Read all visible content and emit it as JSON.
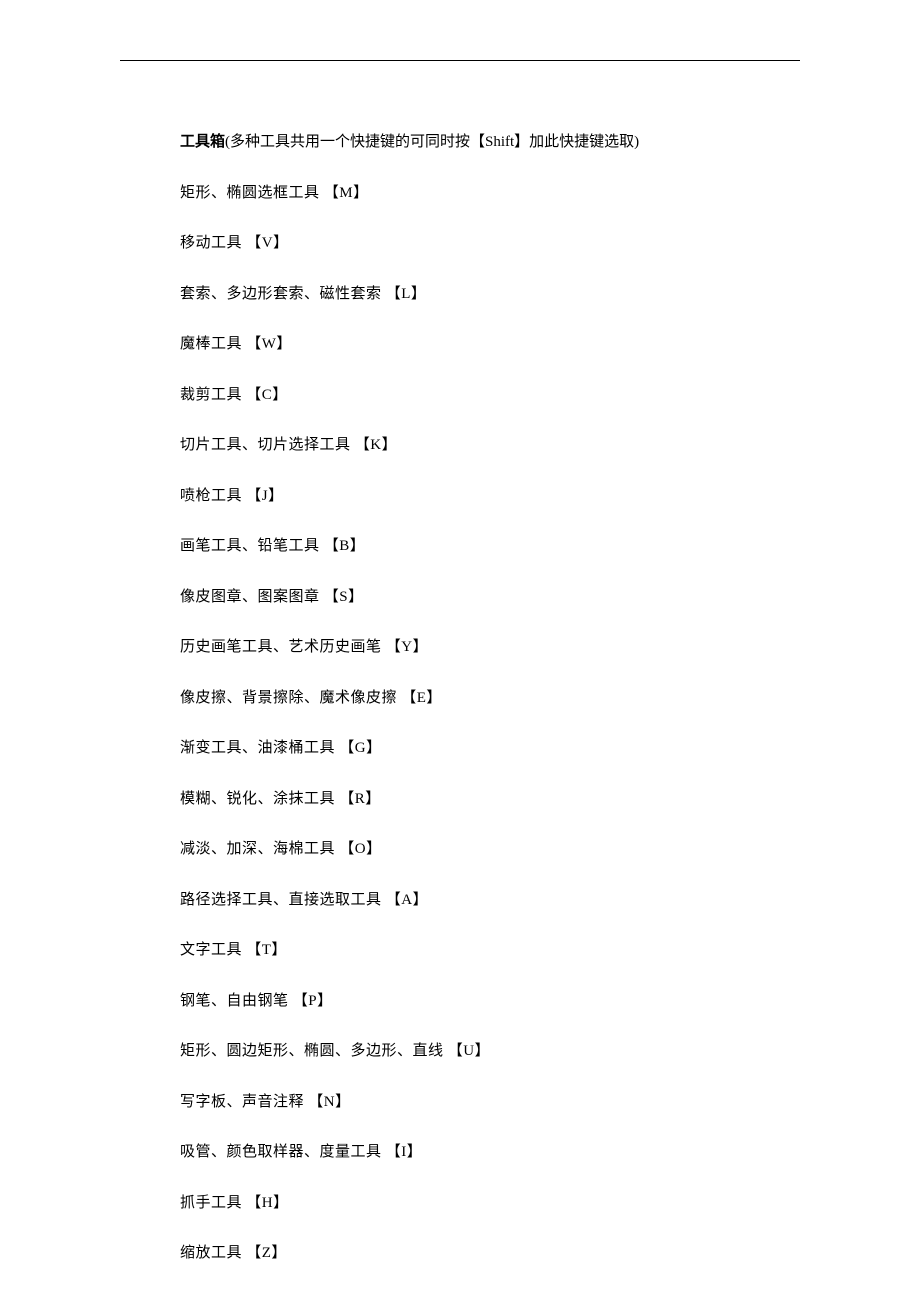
{
  "heading": {
    "title": "工具箱",
    "subtitle": "(多种工具共用一个快捷键的可同时按【Shift】加此快捷键选取)"
  },
  "shortcuts": [
    {
      "label": "矩形、椭圆选框工具 【M】"
    },
    {
      "label": "移动工具 【V】"
    },
    {
      "label": "套索、多边形套索、磁性套索 【L】"
    },
    {
      "label": "魔棒工具 【W】"
    },
    {
      "label": "裁剪工具 【C】"
    },
    {
      "label": "切片工具、切片选择工具 【K】"
    },
    {
      "label": "喷枪工具 【J】"
    },
    {
      "label": "画笔工具、铅笔工具 【B】"
    },
    {
      "label": "像皮图章、图案图章 【S】"
    },
    {
      "label": "历史画笔工具、艺术历史画笔 【Y】"
    },
    {
      "label": "像皮擦、背景擦除、魔术像皮擦 【E】"
    },
    {
      "label": "渐变工具、油漆桶工具 【G】"
    },
    {
      "label": "模糊、锐化、涂抹工具 【R】"
    },
    {
      "label": "减淡、加深、海棉工具 【O】"
    },
    {
      "label": "路径选择工具、直接选取工具 【A】"
    },
    {
      "label": "文字工具 【T】"
    },
    {
      "label": "钢笔、自由钢笔 【P】"
    },
    {
      "label": "矩形、圆边矩形、椭圆、多边形、直线 【U】"
    },
    {
      "label": "写字板、声音注释 【N】"
    },
    {
      "label": "吸管、颜色取样器、度量工具 【I】"
    },
    {
      "label": "抓手工具 【H】"
    },
    {
      "label": "缩放工具 【Z】"
    }
  ]
}
